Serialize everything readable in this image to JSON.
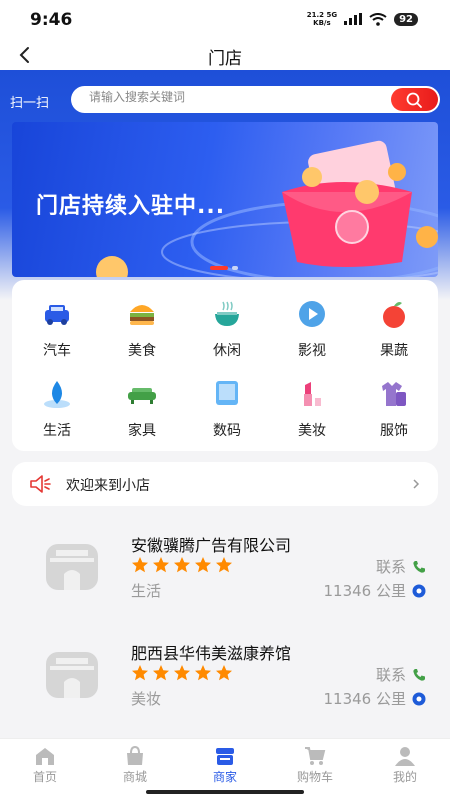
{
  "status": {
    "time": "9:46",
    "net_speed_top": "21.2 5G",
    "net_speed_bottom": "KB/s",
    "battery": "92"
  },
  "title_bar": {
    "title": "门店"
  },
  "search": {
    "scan_label": "扫一扫",
    "placeholder": "请输入搜索关键词"
  },
  "banner": {
    "text": "门店持续入驻中...",
    "slide_count": 2,
    "active_slide": 1
  },
  "categories": [
    {
      "label": "汽车",
      "icon": "car-icon"
    },
    {
      "label": "美食",
      "icon": "burger-icon"
    },
    {
      "label": "休闲",
      "icon": "teacup-icon"
    },
    {
      "label": "影视",
      "icon": "play-icon"
    },
    {
      "label": "果蔬",
      "icon": "apple-icon"
    },
    {
      "label": "生活",
      "icon": "water-drop-icon"
    },
    {
      "label": "家具",
      "icon": "sofa-icon"
    },
    {
      "label": "数码",
      "icon": "tablet-icon"
    },
    {
      "label": "美妆",
      "icon": "lipstick-icon"
    },
    {
      "label": "服饰",
      "icon": "clothes-icon"
    }
  ],
  "notice": {
    "text": "欢迎来到小店"
  },
  "stores": [
    {
      "name": "安徽骥腾广告有限公司",
      "rating": 5,
      "category": "生活",
      "contact_label": "联系",
      "distance": "11346 公里"
    },
    {
      "name": "肥西县华伟美滋康养馆",
      "rating": 5,
      "category": "美妆",
      "contact_label": "联系",
      "distance": "11346 公里"
    }
  ],
  "bottom_nav": [
    {
      "label": "首页",
      "icon": "home-icon",
      "active": false
    },
    {
      "label": "商城",
      "icon": "shopping-bag-icon",
      "active": false
    },
    {
      "label": "商家",
      "icon": "store-icon",
      "active": true
    },
    {
      "label": "购物车",
      "icon": "cart-icon",
      "active": false
    },
    {
      "label": "我的",
      "icon": "user-icon",
      "active": false
    }
  ],
  "colors": {
    "brand_blue": "#2a5be6",
    "accent_red": "#ff3a2a",
    "star_orange": "#ff8a00"
  }
}
